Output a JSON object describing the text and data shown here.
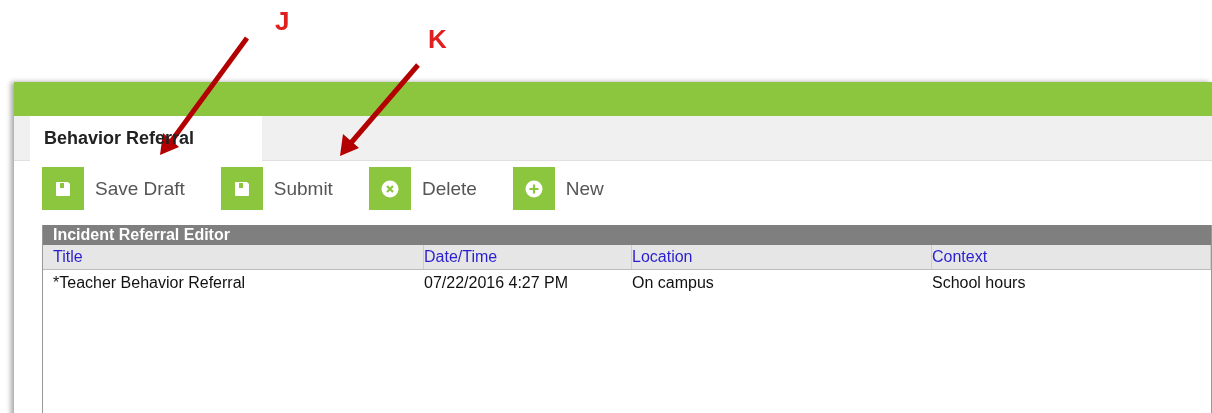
{
  "annotations": [
    {
      "label": "J"
    },
    {
      "label": "K"
    }
  ],
  "tabs": [
    {
      "label": "Behavior Referral",
      "selected": true
    }
  ],
  "toolbar": [
    {
      "label": "Save Draft",
      "kind": "save"
    },
    {
      "label": "Submit",
      "kind": "save"
    },
    {
      "label": "Delete",
      "kind": "delete"
    },
    {
      "label": "New",
      "kind": "new"
    }
  ],
  "editor": {
    "title": "Incident Referral Editor",
    "columns": [
      "Title",
      "Date/Time",
      "Location",
      "Context"
    ],
    "rows": [
      [
        "*Teacher Behavior Referral",
        "07/22/2016 4:27 PM",
        "On campus",
        "School hours"
      ]
    ]
  }
}
